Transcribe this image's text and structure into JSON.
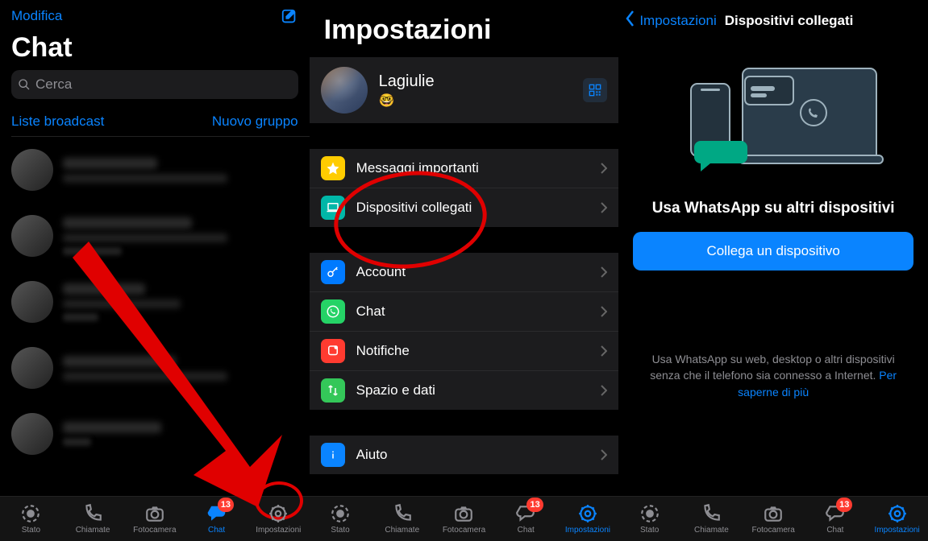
{
  "screen1": {
    "edit": "Modifica",
    "title": "Chat",
    "search_placeholder": "Cerca",
    "broadcast": "Liste broadcast",
    "new_group": "Nuovo gruppo"
  },
  "screen2": {
    "title": "Impostazioni",
    "profile_name": "Lagiulie",
    "profile_emoji": "🤓",
    "group1": [
      {
        "label": "Messaggi importanti",
        "icon": "star",
        "bg": "bg-yellow"
      },
      {
        "label": "Dispositivi collegati",
        "icon": "laptop",
        "bg": "bg-teal"
      }
    ],
    "group2": [
      {
        "label": "Account",
        "icon": "key",
        "bg": "bg-blue"
      },
      {
        "label": "Chat",
        "icon": "whatsapp",
        "bg": "bg-green"
      },
      {
        "label": "Notifiche",
        "icon": "bell",
        "bg": "bg-red"
      },
      {
        "label": "Spazio e dati",
        "icon": "arrows",
        "bg": "bg-green2"
      }
    ],
    "group3": [
      {
        "label": "Aiuto",
        "icon": "info",
        "bg": "bg-blue2"
      }
    ]
  },
  "screen3": {
    "back": "Impostazioni",
    "title": "Dispositivi collegati",
    "heading": "Usa WhatsApp su altri dispositivi",
    "button": "Collega un dispositivo",
    "desc_line1": "Usa WhatsApp su web, desktop o altri dispositivi senza che il telefono sia connesso a Internet. ",
    "learn_more": "Per saperne di più"
  },
  "tabbar": {
    "stato": "Stato",
    "chiamate": "Chiamate",
    "fotocamera": "Fotocamera",
    "chat": "Chat",
    "impostazioni": "Impostazioni",
    "badge": "13"
  }
}
